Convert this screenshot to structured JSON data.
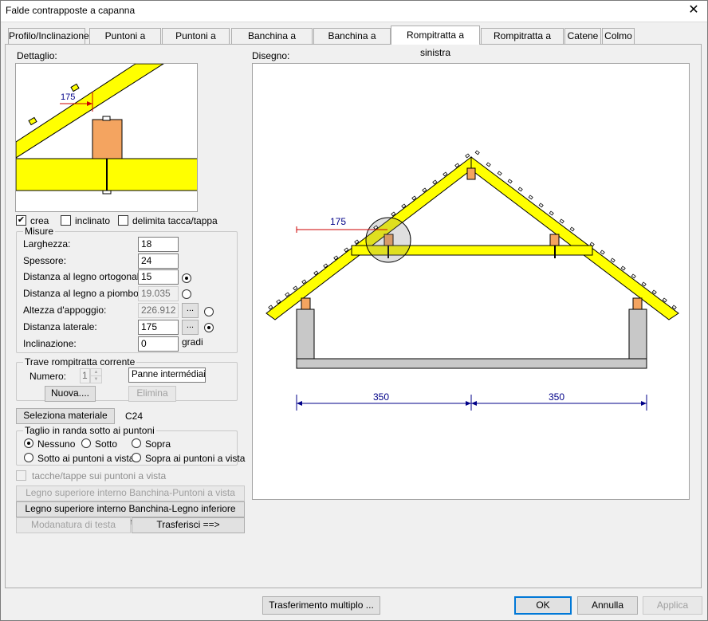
{
  "window": {
    "title": "Falde contrapposte a capanna",
    "close_glyph": "✕"
  },
  "tabs": [
    {
      "label": "Profilo/Inclinazione"
    },
    {
      "label": "Puntoni a sinistra"
    },
    {
      "label": "Puntoni a destra"
    },
    {
      "label": "Banchina a sinistra"
    },
    {
      "label": "Banchina a destra"
    },
    {
      "label": "Rompitratta a sinistra"
    },
    {
      "label": "Rompitratta a destra"
    },
    {
      "label": "Catene"
    },
    {
      "label": "Colmo"
    }
  ],
  "active_tab": "Rompitratta a sinistra",
  "detail": {
    "label": "Dettaglio:",
    "dimension": "175"
  },
  "drawing": {
    "label": "Disegno:",
    "dimension_top": "175",
    "dimension_left": "350",
    "dimension_right": "350"
  },
  "checks": {
    "crea": {
      "label": "crea",
      "checked": true
    },
    "inclinato": {
      "label": "inclinato",
      "checked": false
    },
    "delimita": {
      "label": "delimita tacca/tappa",
      "checked": false
    }
  },
  "misure": {
    "group_label": "Misure",
    "larghezza": {
      "label": "Larghezza:",
      "value": "18"
    },
    "spessore": {
      "label": "Spessore:",
      "value": "24"
    },
    "dist_ortogonale": {
      "label": "Distanza al legno ortogonale:",
      "value": "15"
    },
    "dist_piombo": {
      "label": "Distanza al legno a piombo:",
      "value": "19.035"
    },
    "altezza_appoggio": {
      "label": "Altezza d'appoggio:",
      "value": "226.912"
    },
    "dist_laterale": {
      "label": "Distanza laterale:",
      "value": "175"
    },
    "inclinazione": {
      "label": "Inclinazione:",
      "value": "0",
      "unit": "gradi"
    },
    "ellipsis": "..."
  },
  "trave": {
    "group_label": "Trave rompitratta corrente",
    "numero_label": "Numero:",
    "numero_value": "1",
    "name_value": "Panne intermédiaire",
    "nuova": "Nuova....",
    "elimina": "Elimina"
  },
  "materiale": {
    "button": "Seleziona materiale",
    "value": "C24"
  },
  "taglio": {
    "group_label": "Taglio in randa sotto ai puntoni",
    "options": [
      "Nessuno",
      "Sotto",
      "Sopra",
      "Sotto ai puntoni a vista",
      "Sopra ai puntoni a vista"
    ],
    "selected": "Nessuno"
  },
  "tacche": {
    "label": "tacche/tappe sui puntoni a vista",
    "checked": false
  },
  "actions": {
    "legno_banchina_puntoni": "Legno superiore interno Banchina-Puntoni a vista",
    "legno_banchina_inferiore": "Legno superiore interno Banchina-Legno inferiore puntoni",
    "modanatura": "Modanatura di testa",
    "trasferisci": "Trasferisci ==>"
  },
  "footer": {
    "trasferimento": "Trasferimento multiplo ...",
    "ok": "OK",
    "annulla": "Annulla",
    "applica": "Applica"
  },
  "colors": {
    "timber": "#ffff00",
    "block": "#f4a460",
    "wall": "#c8c8c8",
    "dimension_red": "#cc0000",
    "dimension_blue": "#000088",
    "accent": "#0078d7"
  }
}
